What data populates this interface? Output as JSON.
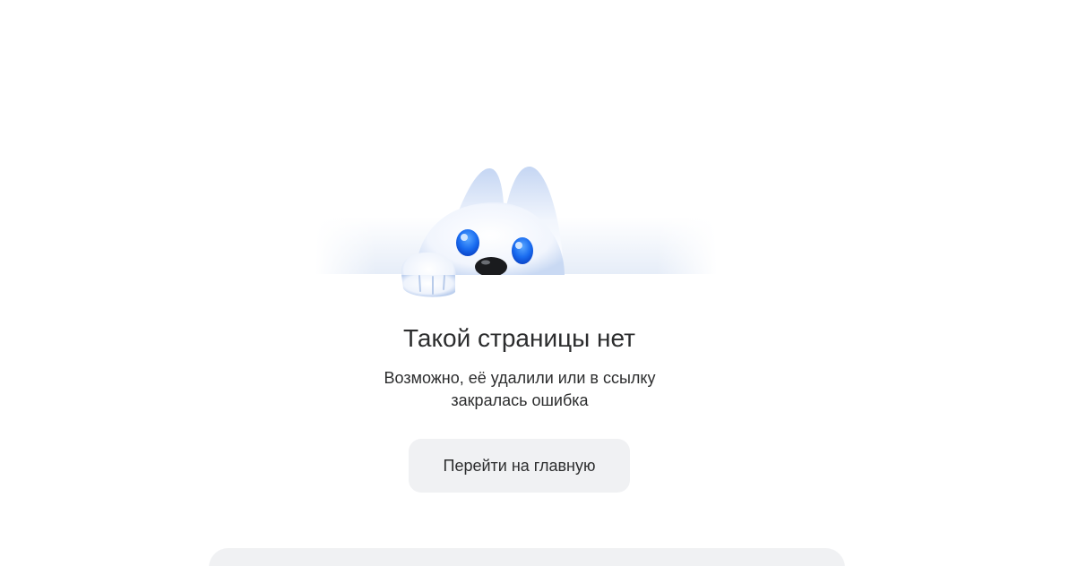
{
  "error": {
    "title": "Такой страницы нет",
    "subtitle_line1": "Возможно, её удалили или в ссылку",
    "subtitle_line2": "закралась ошибка"
  },
  "actions": {
    "home_button_label": "Перейти на главную"
  },
  "illustration": {
    "icon": "sad-fox-mascot-icon",
    "accent_color": "#1a6cf0"
  }
}
